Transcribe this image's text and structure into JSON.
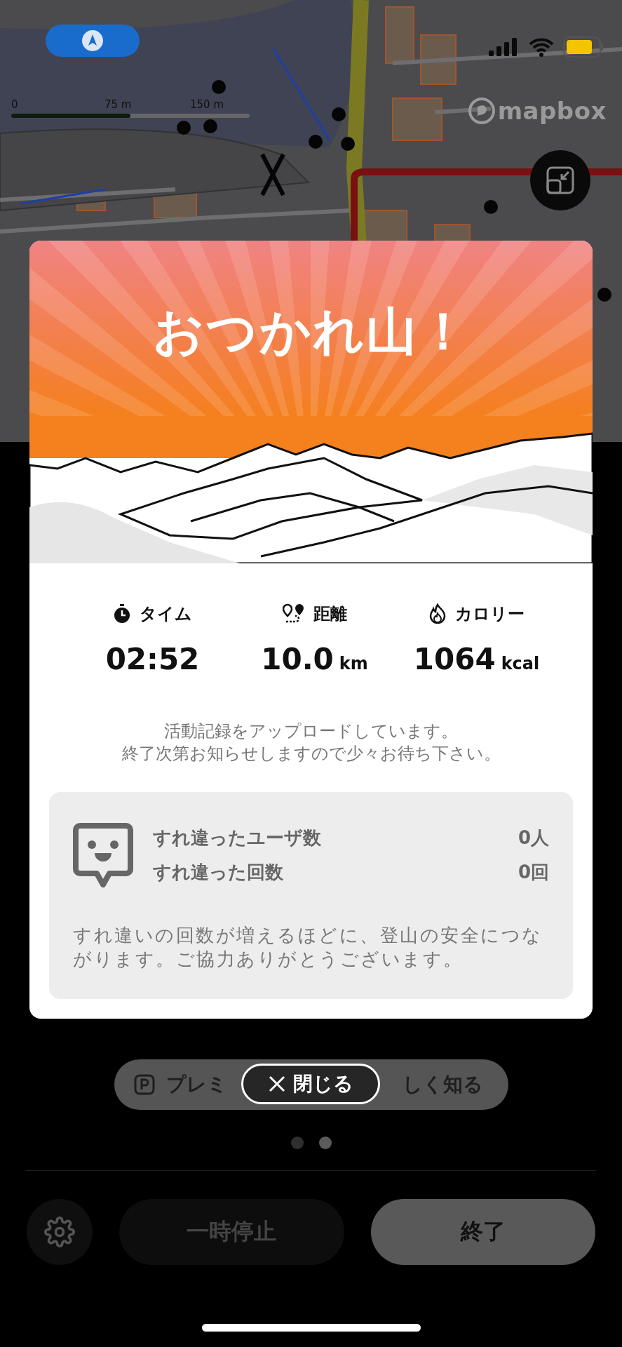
{
  "map": {
    "scale_labels": [
      "0",
      "75 m",
      "150 m"
    ],
    "attribution": "mapbox"
  },
  "modal": {
    "title": "おつかれ山！",
    "stats": [
      {
        "kind": "time",
        "label": "タイム",
        "value": "02:52"
      },
      {
        "kind": "distance",
        "label": "距離",
        "value": "10.0",
        "unit": "km"
      },
      {
        "kind": "calories",
        "label": "カロリー",
        "value": "1064",
        "unit": "kcal"
      }
    ],
    "message": [
      "活動記録をアップロードしています。",
      "終了次第お知らせしますので少々お待ち下さい。"
    ],
    "encounters": {
      "rows": [
        {
          "label": "すれ違ったユーザ数",
          "value": "0人"
        },
        {
          "label": "すれ違った回数",
          "value": "0回"
        }
      ],
      "note": "すれ違いの回数が増えるほどに、登山の安全につながります。ご協力ありがとうございます。"
    }
  },
  "close_button": "閉じる",
  "premium_button": {
    "parts": [
      "プレミ",
      "しく知る"
    ]
  },
  "pager": [
    {
      "selected": false
    },
    {
      "selected": true
    }
  ],
  "controls": {
    "pause": {
      "label": "一時停止",
      "disabled": true
    },
    "end": {
      "label": "終了",
      "disabled": false
    }
  }
}
